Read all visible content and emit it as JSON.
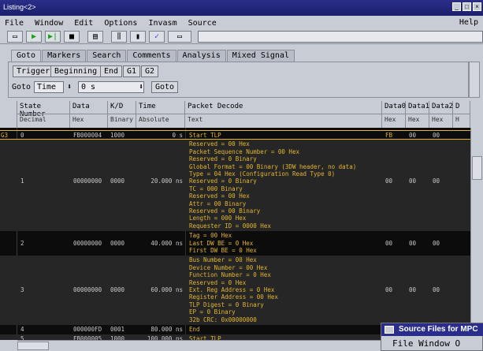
{
  "window": {
    "title": "Listing<2>"
  },
  "menu": [
    "File",
    "Window",
    "Edit",
    "Options",
    "Invasm",
    "Source"
  ],
  "menu_help": "Help",
  "tabs": [
    "Goto",
    "Markers",
    "Search",
    "Comments",
    "Analysis",
    "Mixed Signal"
  ],
  "goto": {
    "trigger": "Trigger",
    "beginning": "Beginning",
    "end": "End",
    "g1": "G1",
    "g2": "G2",
    "goto_label": "Goto",
    "time_select": "Time",
    "value": "0 s",
    "goto_button": "Goto"
  },
  "columns": [
    {
      "name": "State Number",
      "sub": "Decimal"
    },
    {
      "name": "Data",
      "sub": "Hex"
    },
    {
      "name": "K/D",
      "sub": "Binary"
    },
    {
      "name": "Time",
      "sub": "Absolute"
    },
    {
      "name": "Packet Decode",
      "sub": "Text"
    },
    {
      "name": "Data0",
      "sub": "Hex"
    },
    {
      "name": "Data1",
      "sub": "Hex"
    },
    {
      "name": "Data2",
      "sub": "Hex"
    },
    {
      "name": "D",
      "sub": "H"
    }
  ],
  "rows": [
    {
      "marker": "G3",
      "state": "0",
      "data": "FB000004",
      "kd": "1000",
      "time": "0 s",
      "decode": [
        "Start TLP"
      ],
      "d0": "FB",
      "d1": "00",
      "d2": "00"
    },
    {
      "state": "1",
      "data": "00000000",
      "kd": "0000",
      "time": "20.000 ns",
      "decode": [
        "Reserved = 00 Hex",
        "Packet Sequence Number = 00 Hex",
        "Reserved = 0 Binary",
        "Global Format = 00 Binary (3DW header, no data)",
        "Type = 04 Hex (Configuration Read Type 0)",
        "Reserved = 0 Binary",
        "TC = 000 Binary",
        "Reserved = 00 Hex",
        "Attr = 00 Binary",
        "Reserved = 00 Binary",
        "Length = 000 Hex",
        "Requester ID = 0000 Hex"
      ],
      "d0": "00",
      "d1": "00",
      "d2": "00"
    },
    {
      "state": "2",
      "data": "00000000",
      "kd": "0000",
      "time": "40.000 ns",
      "decode": [
        "Tag = 00 Hex",
        "Last DW BE = 0 Hex",
        "First DW BE = 0 Hex"
      ],
      "d0": "00",
      "d1": "00",
      "d2": "00"
    },
    {
      "state": "3",
      "data": "00000000",
      "kd": "0000",
      "time": "60.000 ns",
      "decode": [
        "Bus Number = 00 Hex",
        "Device Number = 00 Hex",
        "Function Number = 0 Hex",
        "Reserved = 0 Hex",
        "Ext. Reg Address = 0 Hex",
        "Register Address = 00 Hex",
        "TLP Digest = 0 Binary",
        "EP = 0 Binary",
        "32b CRC: 0x00000000"
      ],
      "d0": "00",
      "d1": "00",
      "d2": "00"
    },
    {
      "state": "4",
      "data": "000000FD",
      "kd": "0001",
      "time": "80.000 ns",
      "decode": [
        "End"
      ],
      "d0": "",
      "d1": "",
      "d2": ""
    },
    {
      "state": "5",
      "data": "FB000005",
      "kd": "1000",
      "time": "100.000 ns",
      "decode": [
        "Start TLP"
      ],
      "d0": "",
      "d1": "",
      "d2": ""
    }
  ],
  "popup": {
    "title": "Source Files for MPC",
    "menu": "File  Window  O"
  },
  "colors": {
    "decode_text": "#e2b52e",
    "title_bar": "#2a2e8a",
    "listing_bg": "#0c0c0c"
  }
}
